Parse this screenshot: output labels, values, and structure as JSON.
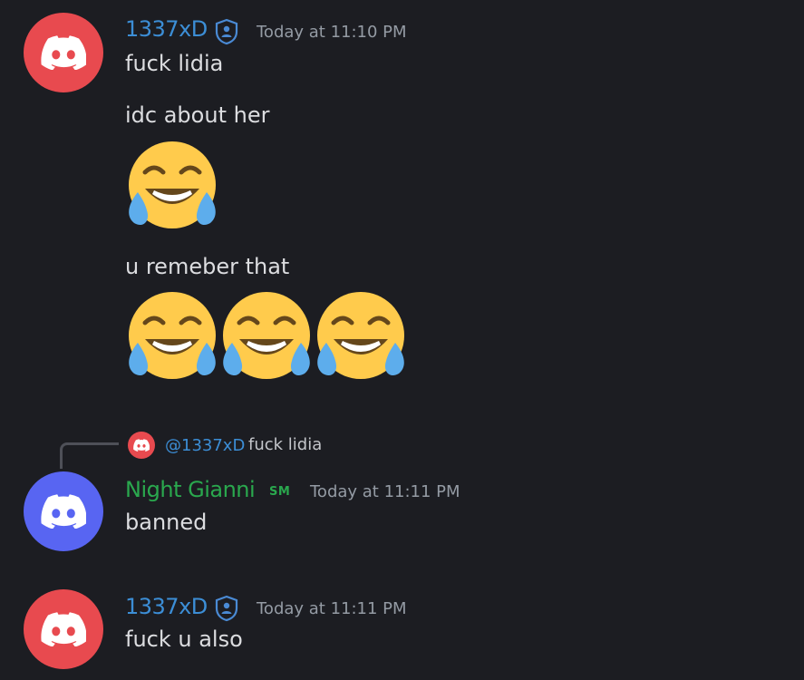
{
  "colors": {
    "background": "#1c1d22",
    "avatar_red": "#e84a4f",
    "avatar_blue": "#5865f2",
    "name_blue": "#3c8ed6",
    "name_green": "#2aa84e",
    "timestamp": "#949ba4"
  },
  "icons": {
    "discord_logo": "discord-logo-icon",
    "role_badge": "shield-badge-icon",
    "emoji": "face-with-tears-of-joy"
  },
  "messages": [
    {
      "author": "1337xD",
      "timestamp": "Today at 11:10 PM",
      "lines": [
        "fuck lidia",
        "idc about her"
      ],
      "line3": "u remeber that"
    },
    {
      "reply_to": {
        "mention": "@1337xD",
        "text": "fuck lidia"
      },
      "author": "Night Gianni",
      "role_tag": "SM",
      "timestamp": "Today at 11:11 PM",
      "text": "banned"
    },
    {
      "author": "1337xD",
      "timestamp": "Today at 11:11 PM",
      "text": "fuck u also"
    }
  ]
}
